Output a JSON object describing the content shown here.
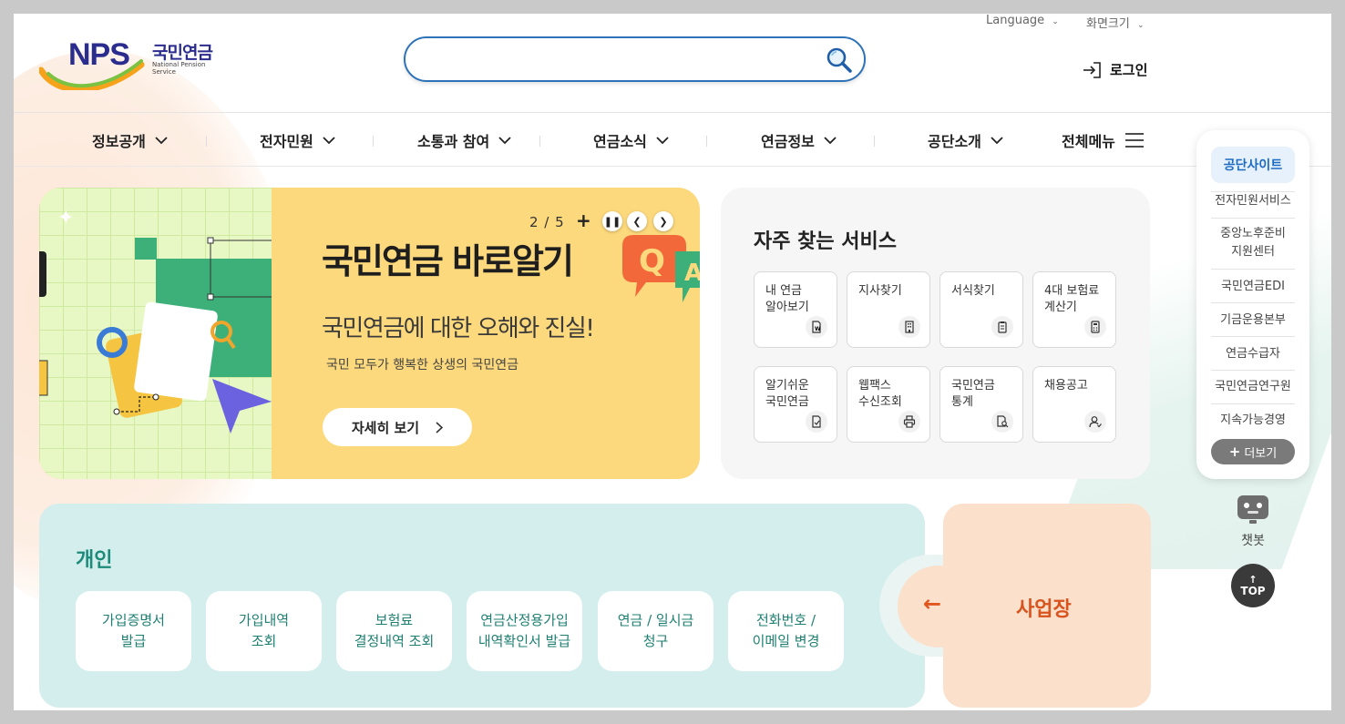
{
  "header": {
    "logo_brand": "NPS",
    "logo_kr": "국민연금",
    "logo_en": "National Pension Service",
    "search_placeholder": "",
    "language_label": "Language",
    "zoom_label": "화면크기",
    "login_label": "로그인"
  },
  "gnb": [
    {
      "label": "정보공개"
    },
    {
      "label": "전자민원"
    },
    {
      "label": "소통과 참여"
    },
    {
      "label": "연금소식"
    },
    {
      "label": "연금정보"
    },
    {
      "label": "공단소개"
    }
  ],
  "gnb_all_menu": "전체메뉴",
  "banner": {
    "counter": "2 / 5",
    "title": "국민연금 바로알기",
    "subtitle": "국민연금에 대한 오해와 진실!",
    "description": "국민 모두가 행복한 상생의 국민연금",
    "button_label": "자세히 보기",
    "qa_q": "Q",
    "qa_a": "A"
  },
  "services": {
    "title": "자주 찾는 서비스",
    "items": [
      {
        "label": "내 연금\n알아보기",
        "icon": "document-icon"
      },
      {
        "label": "지사찾기",
        "icon": "building-icon"
      },
      {
        "label": "서식찾기",
        "icon": "clipboard-icon"
      },
      {
        "label": "4대 보험료\n계산기",
        "icon": "calculator-icon"
      },
      {
        "label": "알기쉬운\n국민연금",
        "icon": "check-document-icon"
      },
      {
        "label": "웹팩스\n수신조회",
        "icon": "printer-icon"
      },
      {
        "label": "국민연금\n통계",
        "icon": "search-document-icon"
      },
      {
        "label": "채용공고",
        "icon": "user-check-icon"
      }
    ]
  },
  "personal": {
    "title": "개인",
    "buttons": [
      {
        "label": "가입증명서\n발급"
      },
      {
        "label": "가입내역\n조회"
      },
      {
        "label": "보험료\n결정내역 조회"
      },
      {
        "label": "연금산정용가입\n내역확인서 발급"
      },
      {
        "label": "연금 / 일시금\n청구"
      },
      {
        "label": "전화번호 /\n이메일 변경"
      }
    ]
  },
  "business": {
    "label": "사업장",
    "arrow": "←"
  },
  "side_panel": {
    "header": "공단사이트",
    "items": [
      {
        "label": "전자민원서비스"
      },
      {
        "label": "중앙노후준비\n지원센터"
      },
      {
        "label": "국민연금EDI"
      },
      {
        "label": "기금운용본부"
      },
      {
        "label": "연금수급자"
      },
      {
        "label": "국민연금연구원"
      },
      {
        "label": "지속가능경영"
      }
    ],
    "more_label": "더보기"
  },
  "chatbot_label": "챗봇",
  "top_label": "TOP",
  "colors": {
    "brand_navy": "#2b2d8e",
    "search_border": "#2e73b8",
    "banner_yellow": "#fdd97d",
    "personal_bg": "#d3eeec",
    "personal_text": "#1d7f71",
    "business_bg": "#fbe0cc",
    "business_text": "#d9531d",
    "side_header_text": "#1e6bc4"
  }
}
